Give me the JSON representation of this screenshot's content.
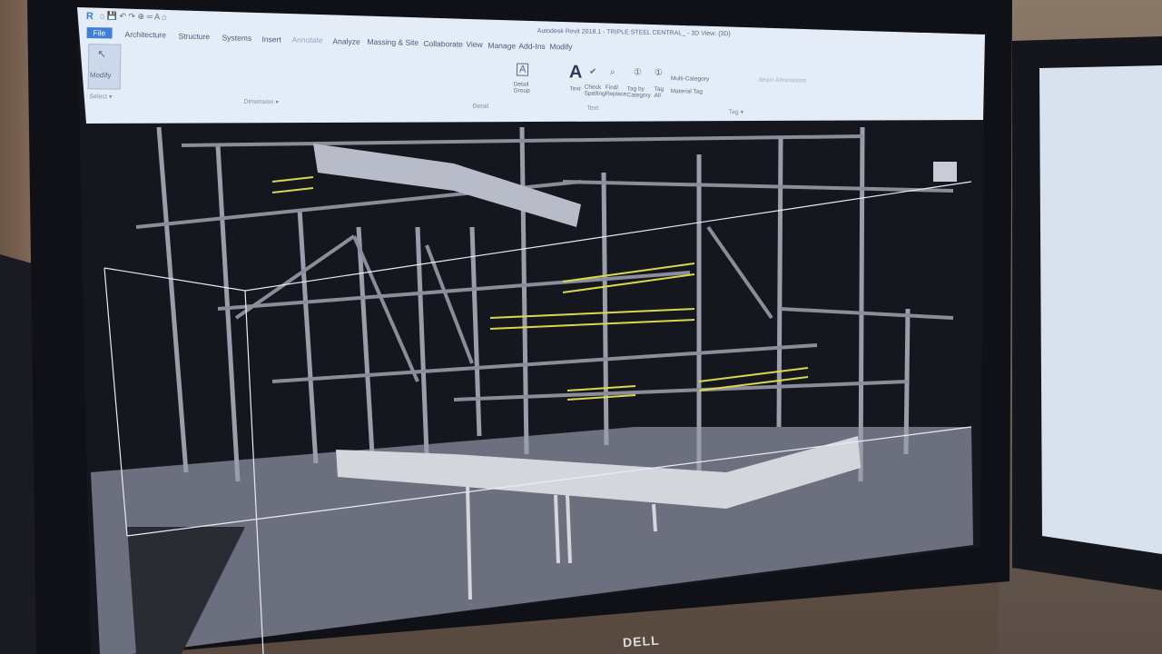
{
  "window": {
    "title": "Autodesk Revit 2018.1 - TRIPLE STEEL CENTRAL_ - 3D View: {3D}"
  },
  "ribbon": {
    "tabs": [
      "File",
      "Architecture",
      "Structure",
      "Systems",
      "Insert",
      "Annotate",
      "Analyze",
      "Massing & Site",
      "Collaborate",
      "View",
      "Manage",
      "Add-Ins",
      "Modify"
    ],
    "modify_label": "Modify",
    "select_label": "Select ▾",
    "dimension_label": "Dimension ▾",
    "detail_group_label": "Detail Group",
    "detail_label": "Detail",
    "text_label": "Text",
    "check_spelling_label": "Check Spelling",
    "find_replace_label": "Find/ Replace",
    "text_group_label": "Text",
    "tag_by_category_label": "Tag by Category",
    "tag_all_label": "Tag All",
    "multi_category_label": "Multi-Category",
    "material_tag_label": "Material Tag",
    "tag_group_label": "Tag ▾",
    "beam_annotations_label": "Beam Annotations"
  },
  "monitor": {
    "brand": "DELL"
  },
  "colors": {
    "viewport_bg": "#14161f",
    "steel": "#9a9eab",
    "railing": "#d8d84a",
    "file_tab": "#3f7fd8"
  }
}
